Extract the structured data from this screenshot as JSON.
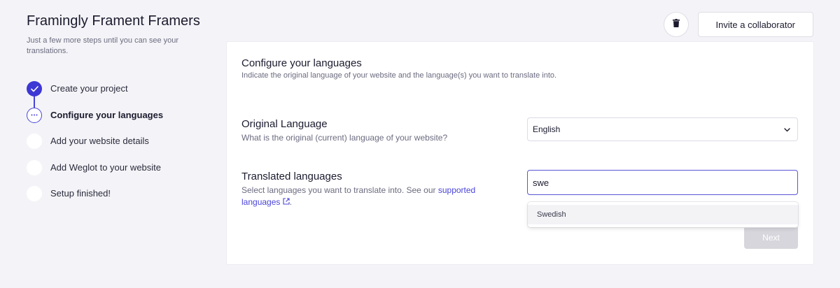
{
  "header": {
    "project_title": "Framingly Frament Framers",
    "subtitle": "Just a few more steps until you can see your translations.",
    "invite_label": "Invite a collaborator"
  },
  "steps": [
    {
      "label": "Create your project",
      "state": "done"
    },
    {
      "label": "Configure your languages",
      "state": "active"
    },
    {
      "label": "Add your website details",
      "state": "todo"
    },
    {
      "label": "Add Weglot to your website",
      "state": "todo"
    },
    {
      "label": "Setup finished!",
      "state": "todo"
    }
  ],
  "card": {
    "title": "Configure your languages",
    "subtitle": "Indicate the original language of your website and the language(s) you want to translate into."
  },
  "original_language": {
    "label": "Original Language",
    "help": "What is the original (current) language of your website?",
    "selected": "English"
  },
  "translated_languages": {
    "label": "Translated languages",
    "help_prefix": "Select languages you want to translate into. See our ",
    "help_link": "supported languages",
    "help_suffix": ".",
    "search_value": "swe",
    "suggestions": [
      "Swedish"
    ]
  },
  "next_label": "Next",
  "colors": {
    "accent": "#3d37d4",
    "background": "#f4f4f8",
    "disabled_button": "#d6d6dc"
  }
}
